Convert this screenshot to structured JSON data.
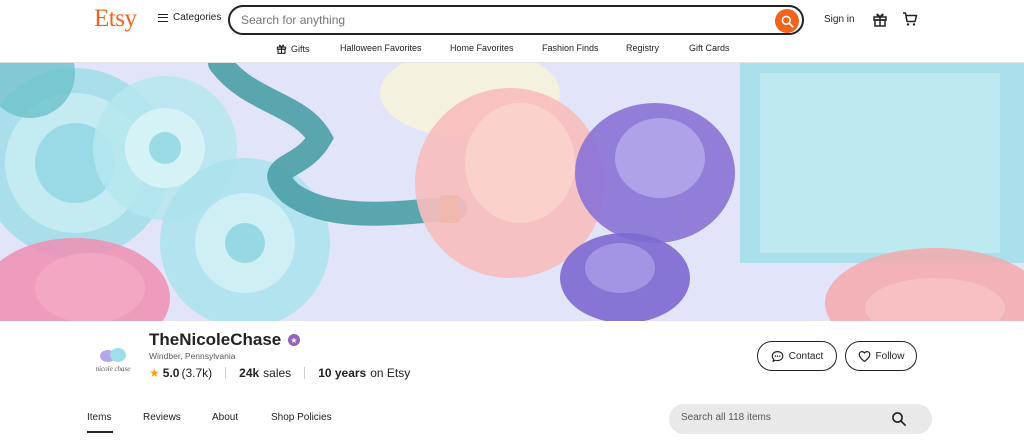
{
  "header": {
    "logo": "Etsy",
    "categories_label": "Categories",
    "search_placeholder": "Search for anything",
    "sign_in_label": "Sign in"
  },
  "subnav": {
    "items": [
      "Gifts",
      "Halloween Favorites",
      "Home Favorites",
      "Fashion Finds",
      "Registry",
      "Gift Cards"
    ]
  },
  "shop": {
    "logo_text": "nicole chase",
    "name": "TheNicoleChase",
    "location": "Windber, Pennsylvania",
    "rating": "5.0",
    "review_count": "(3.7k)",
    "sales_count": "24k",
    "sales_label": "sales",
    "years": "10 years",
    "years_suffix": "on Etsy",
    "contact_label": "Contact",
    "follow_label": "Follow"
  },
  "tabs": [
    "Items",
    "Reviews",
    "About",
    "Shop Policies"
  ],
  "items_search": {
    "placeholder": "Search all 118 items"
  },
  "colors": {
    "brand": "#f1641e",
    "star_seller": "#9560b8",
    "rating_star": "#f1a11e"
  },
  "icons": {
    "search": "search-icon",
    "gift": "gift-icon",
    "cart": "cart-icon",
    "contact": "chat-bubble-icon",
    "follow": "heart-icon",
    "star_seller": "star-seller-badge-icon"
  }
}
